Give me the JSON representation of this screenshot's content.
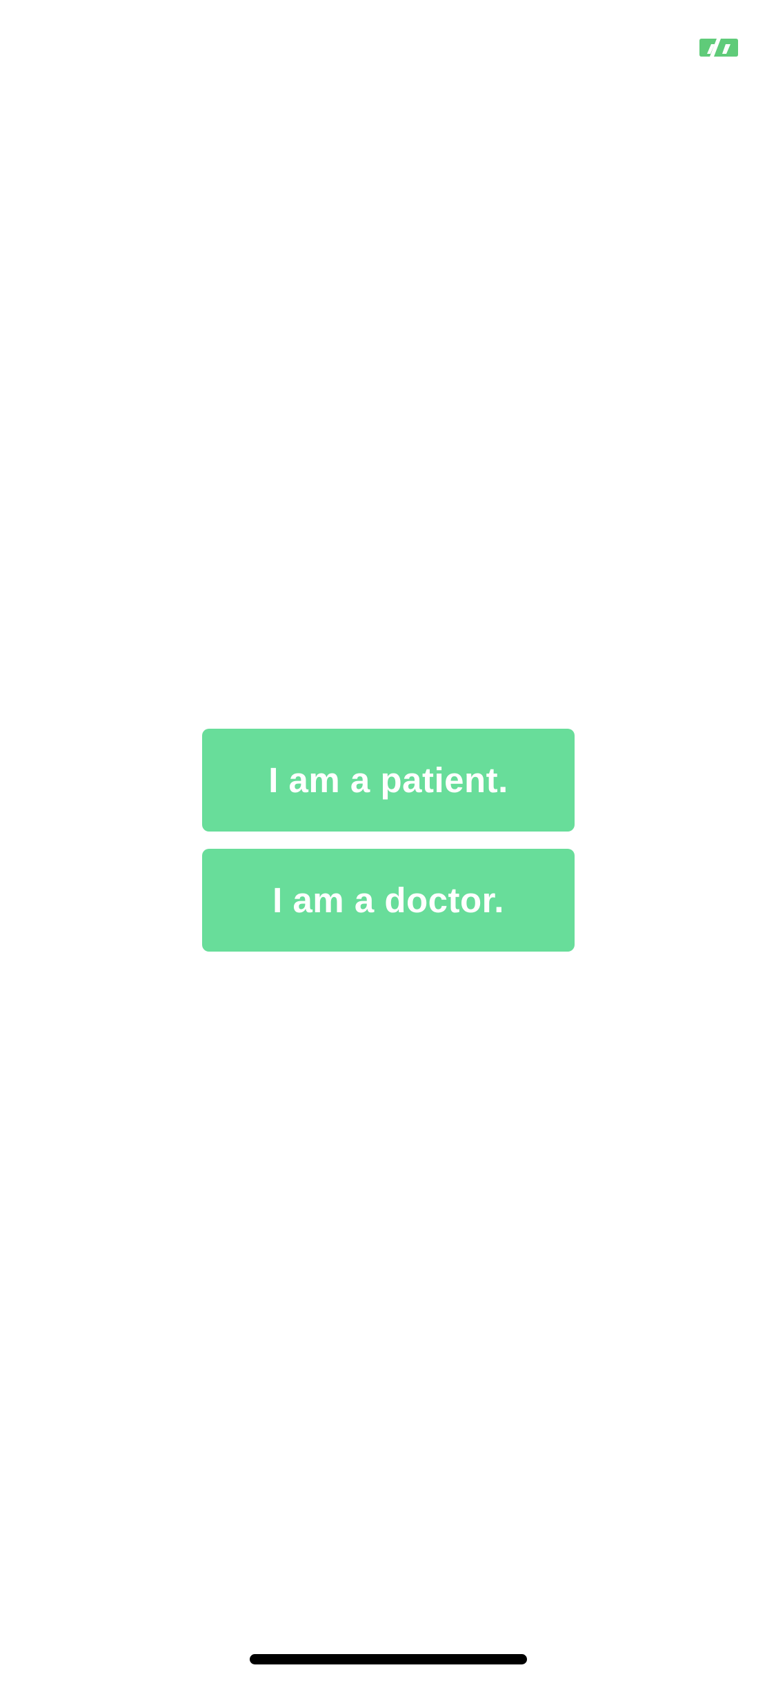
{
  "colors": {
    "accent": "#68DD9A",
    "icon": "#5FCB79",
    "button_text": "#FFFFFF",
    "background": "#FFFFFF",
    "home_indicator": "#000000"
  },
  "header": {
    "corner_icon": "quote-icon"
  },
  "main": {
    "patient_button_label": "I am a patient.",
    "doctor_button_label": "I am a doctor."
  }
}
